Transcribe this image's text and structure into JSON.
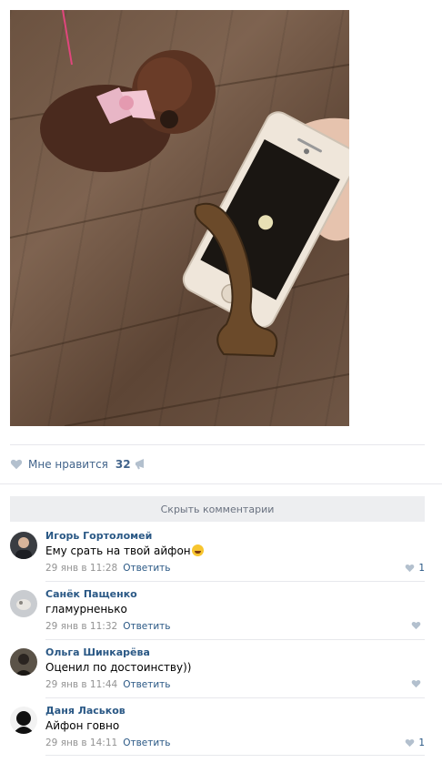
{
  "post": {
    "photo_icon": "post-photo",
    "likes": {
      "label": "Мне нравится",
      "count": "32"
    }
  },
  "comments_toggle": "Скрыть комментарии",
  "comments": [
    {
      "author": "Игорь Гортоломей",
      "text": "Ему срать на твой айфон",
      "emoji": "laughing-emoji",
      "date": "29 янв в 11:28",
      "reply": "Ответить",
      "likes": "1"
    },
    {
      "author": "Санёк Пащенко",
      "text": "гламурненько",
      "date": "29 янв в 11:32",
      "reply": "Ответить",
      "likes": ""
    },
    {
      "author": "Ольга Шинкарёва",
      "text": "Оценил по достоинству))",
      "date": "29 янв в 11:44",
      "reply": "Ответить",
      "likes": ""
    },
    {
      "author": "Даня Ласьков",
      "text": "Айфон говно",
      "date": "29 янв в 14:11",
      "reply": "Ответить",
      "likes": "1"
    }
  ],
  "colors": {
    "link": "#2a5885",
    "meta": "#939393",
    "like_icon": "#b3c0ce"
  }
}
